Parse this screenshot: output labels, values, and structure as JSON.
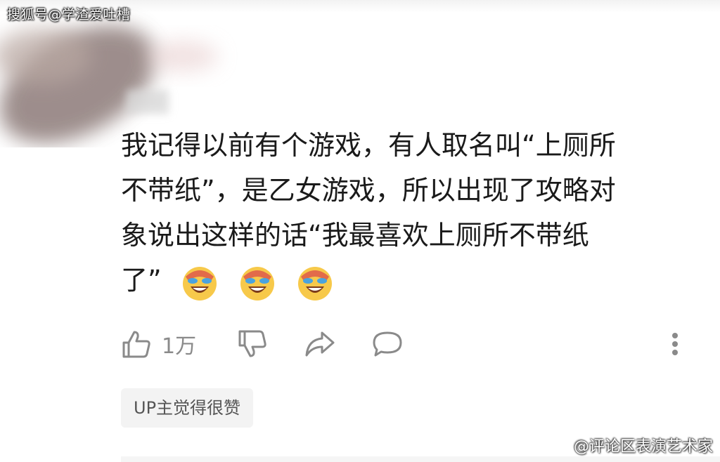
{
  "watermark_top": "搜狐号@学渣爱吐槽",
  "comment": {
    "text_lines": [
      "我记得以前有个游戏，有人取名叫“上厕所",
      "不带纸”，是乙女游戏，所以出现了攻略对",
      "象说出这样的话“我最喜欢上厕所不带纸",
      "了”"
    ],
    "emojis": [
      "crying-laughing-emoji",
      "crying-laughing-emoji",
      "crying-laughing-emoji"
    ]
  },
  "actions": {
    "like_count": "1万",
    "icons": [
      "thumbs-up-icon",
      "thumbs-down-icon",
      "share-icon",
      "comment-icon",
      "more-icon"
    ]
  },
  "tag": {
    "label": "UP主觉得很赞"
  },
  "watermark_bottom": {
    "icon": "weibo-icon",
    "text": "@评论区表演艺术家"
  }
}
